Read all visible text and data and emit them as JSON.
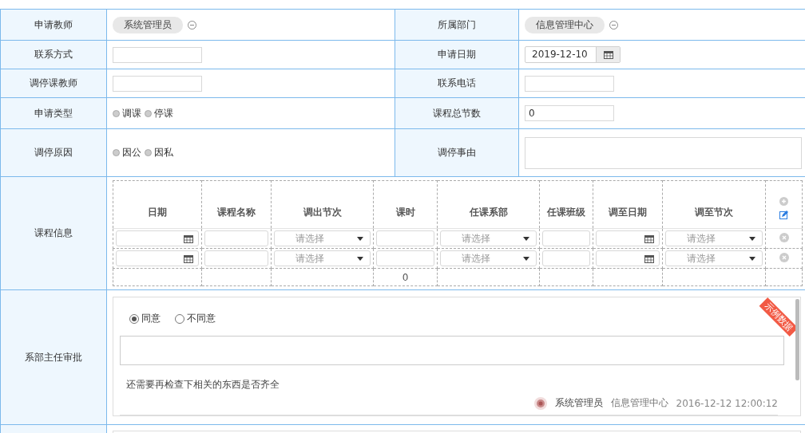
{
  "form_rows": [
    {
      "cells": [
        {
          "label": "申请教师",
          "kind": "tag",
          "value": "系统管理员"
        },
        {
          "label": "所属部门",
          "kind": "tag",
          "value": "信息管理中心"
        }
      ]
    },
    {
      "cells": [
        {
          "label": "联系方式",
          "kind": "input"
        },
        {
          "label": "申请日期",
          "kind": "date",
          "value": "2019-12-10"
        }
      ]
    },
    {
      "cells": [
        {
          "label": "调停课教师",
          "kind": "input"
        },
        {
          "label": "联系电话",
          "kind": "input"
        }
      ]
    },
    {
      "cells": [
        {
          "label": "申请类型",
          "kind": "radio",
          "options": [
            {
              "label": "调课",
              "selected": false
            },
            {
              "label": "停课",
              "selected": false
            }
          ]
        },
        {
          "label": "课程总节数",
          "kind": "input",
          "value": "0"
        }
      ]
    },
    {
      "cells": [
        {
          "label": "调停原因",
          "kind": "radio",
          "options": [
            {
              "label": "因公",
              "selected": false
            },
            {
              "label": "因私",
              "selected": false
            }
          ]
        },
        {
          "label": "调停事由",
          "kind": "textarea"
        }
      ]
    }
  ],
  "course_info": {
    "label": "课程信息",
    "columns": [
      {
        "label": "日期"
      },
      {
        "label": "课程名称"
      },
      {
        "label": "调出节次"
      },
      {
        "label": "课时",
        "total": "0"
      },
      {
        "label": "任课系部"
      },
      {
        "label": "任课班级"
      },
      {
        "label": "调至日期"
      },
      {
        "label": "调至节次"
      }
    ],
    "rows": [
      {
        "cells": [
          {
            "kind": "date"
          },
          {
            "kind": "input"
          },
          {
            "kind": "select",
            "placeholder": "请选择"
          },
          {
            "kind": "input"
          },
          {
            "kind": "select",
            "placeholder": "请选择"
          },
          {
            "kind": "input"
          },
          {
            "kind": "date"
          },
          {
            "kind": "select",
            "placeholder": "请选择"
          }
        ]
      },
      {
        "cells": [
          {
            "kind": "date"
          },
          {
            "kind": "input"
          },
          {
            "kind": "select",
            "placeholder": "请选择"
          },
          {
            "kind": "input"
          },
          {
            "kind": "select",
            "placeholder": "请选择"
          },
          {
            "kind": "input"
          },
          {
            "kind": "date"
          },
          {
            "kind": "select",
            "placeholder": "请选择"
          }
        ]
      }
    ]
  },
  "approval": {
    "label": "系部主任审批",
    "options": [
      {
        "label": "同意",
        "selected": true
      },
      {
        "label": "不同意",
        "selected": false
      }
    ],
    "comment": "还需要再检查下相关的东西是否齐全",
    "signer": "系统管理员",
    "department": "信息管理中心",
    "time": "2016-12-12 12:00:12",
    "ribbon": "示例数据"
  }
}
